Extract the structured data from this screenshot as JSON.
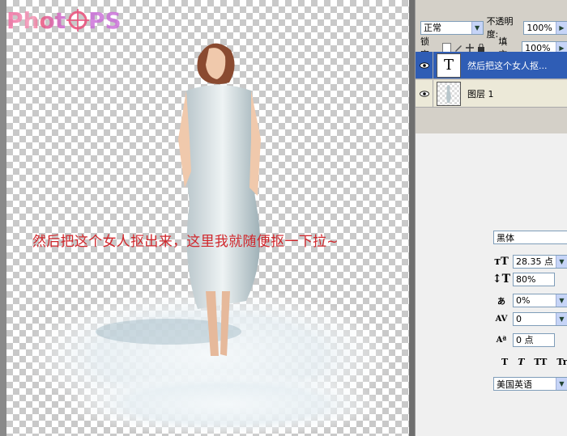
{
  "canvas": {
    "logo_text": "PhotoPS",
    "overlay_text": "然后把这个女人抠出来，这里我就随便抠一下拉~"
  },
  "layers_panel": {
    "blend_mode": "正常",
    "opacity_label": "不透明度:",
    "opacity_value": "100%",
    "lock_label": "锁定:",
    "fill_label": "填充:",
    "fill_value": "100%",
    "layers": [
      {
        "name": "然后把这个女人抠...",
        "type": "text",
        "thumb_glyph": "T",
        "active": true
      },
      {
        "name": "图层 1",
        "type": "image",
        "active": false
      }
    ]
  },
  "character_panel": {
    "font_family": "黑体",
    "font_size": "28.35 点",
    "vertical_scale": "80%",
    "tracking_ratio": "0%",
    "kerning": "0",
    "baseline_shift": "0 点",
    "format_buttons": [
      "T",
      "T",
      "TT",
      "Tr"
    ],
    "language": "美国英语"
  },
  "colors": {
    "text_red": "#d1262b",
    "layer_selected": "#2f5db5",
    "panel_bg": "#d4d0c8"
  }
}
